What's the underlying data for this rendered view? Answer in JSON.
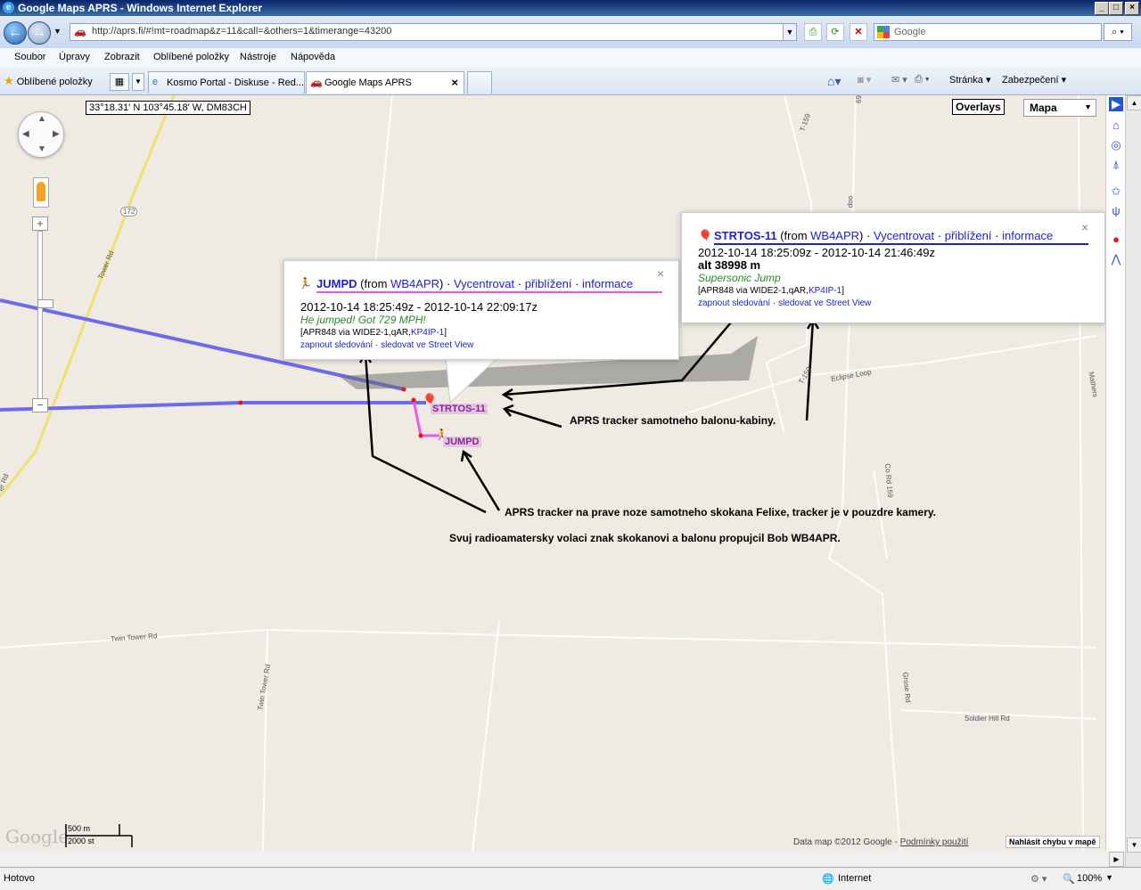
{
  "window": {
    "title": "Google Maps APRS - Windows Internet Explorer"
  },
  "address_bar": {
    "url": "http://aprs.fi/#!mt=roadmap&z=11&call=&others=1&timerange=43200"
  },
  "search": {
    "placeholder": "Google"
  },
  "menu": [
    "Soubor",
    "Úpravy",
    "Zobrazit",
    "Oblíbené položky",
    "Nástroje",
    "Nápověda"
  ],
  "favorites_label": "Oblíbené položky",
  "tabs": [
    {
      "label": "Kosmo Portal - Diskuse - Red..."
    },
    {
      "label": "Google Maps APRS"
    }
  ],
  "command_bar": {
    "page": "Stránka",
    "security": "Zabezpečení"
  },
  "map": {
    "coords": "33°18.31' N 103°45.18' W, DM83CH",
    "overlays": "Overlays",
    "map_type": "Mapa",
    "road_labels": [
      "Tower Rd",
      "Twin Tower Rd",
      "Twin Tower Rd",
      "Eclipse Loop",
      "Co Rd 159",
      "Grose Rd",
      "Soldier Hill Rd",
      "Mathers",
      "T-159",
      "T-159",
      "172",
      "oop",
      "69",
      "er Rd"
    ],
    "copyright": "Data map ©2012 Google -",
    "terms": "Podmínky použití",
    "report": "Nahlásit chybu v mapě",
    "google_logo": "Google",
    "scale": {
      "metric": "500 m",
      "imperial": "2000 st"
    }
  },
  "stations": {
    "strtos_label": "STRTOS-11",
    "jumpd_label": "JUMPD"
  },
  "info_jumpd": {
    "call": "JUMPD",
    "from_pre": "(from ",
    "from_call": "WB4APR",
    "from_post": ")",
    "sep": "·",
    "links": [
      "Vycentrovat",
      "přiblížení",
      "informace"
    ],
    "time": "2012-10-14 18:25:49z - 2012-10-14 22:09:17z",
    "comment": "He jumped! Got 729 MPH!",
    "path_pre": "[APR848 via WIDE2-1,qAR,",
    "path_link": "KP4IP-1",
    "path_post": "]",
    "bottom_links": [
      "zapnout sledování",
      "sledovat ve Street View"
    ]
  },
  "info_strtos": {
    "call": "STRTOS-11",
    "from_pre": "(from ",
    "from_call": "WB4APR",
    "from_post": ")",
    "sep": "·",
    "links": [
      "Vycentrovat",
      "přiblížení",
      "informace"
    ],
    "time": "2012-10-14 18:25:09z - 2012-10-14 21:46:49z",
    "alt": "alt 38998 m",
    "comment": "Supersonic Jump",
    "path_pre": "[APR848 via WIDE2-1,qAR,",
    "path_link": "KP4IP-1",
    "path_post": "]",
    "bottom_links": [
      "zapnout sledování",
      "sledovat ve Street View"
    ]
  },
  "annotations": {
    "balloon": "APRS tracker samotneho balonu-kabiny.",
    "jumper": "APRS tracker na prave noze samotneho skokana Felixe, tracker je v pouzdre kamery.",
    "callsign": "Svuj radioamatersky volaci znak skokanovi a balonu propujcil Bob WB4APR."
  },
  "status": {
    "left": "Hotovo",
    "zone": "Internet",
    "zoom": "100%"
  },
  "colors": {
    "track_blue": "#6b6bf0",
    "track_pink": "#ee55ee",
    "link": "#2222cc",
    "comment_green": "#2a8a2a"
  }
}
